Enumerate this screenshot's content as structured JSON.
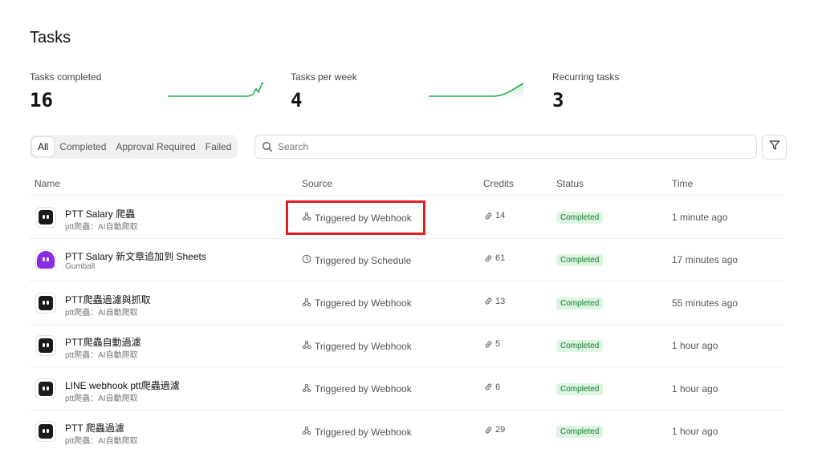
{
  "page": {
    "title": "Tasks"
  },
  "stats": [
    {
      "label": "Tasks completed",
      "value": "16"
    },
    {
      "label": "Tasks per week",
      "value": "4"
    },
    {
      "label": "Recurring tasks",
      "value": "3"
    }
  ],
  "tabs": [
    {
      "label": "All",
      "active": true
    },
    {
      "label": "Completed",
      "active": false
    },
    {
      "label": "Approval Required",
      "active": false
    },
    {
      "label": "Failed",
      "active": false
    }
  ],
  "search": {
    "placeholder": "Search",
    "value": ""
  },
  "table": {
    "columns": [
      "Name",
      "Source",
      "Credits",
      "Status",
      "Time"
    ],
    "rows": [
      {
        "name": "PTT Salary 爬蟲",
        "sub": "ptt爬蟲：AI自動爬取",
        "avatar": "robot-icon",
        "source": "Triggered by Webhook",
        "source_icon": "webhook-icon",
        "credits": "14",
        "status": "Completed",
        "time": "1 minute ago"
      },
      {
        "name": "PTT Salary 新文章追加到 Sheets",
        "sub": "Gumball",
        "avatar": "ghost-icon",
        "source": "Triggered by Schedule",
        "source_icon": "clock-icon",
        "credits": "61",
        "status": "Completed",
        "time": "17 minutes ago"
      },
      {
        "name": "PTT爬蟲過濾與抓取",
        "sub": "ptt爬蟲：AI自動爬取",
        "avatar": "robot-icon",
        "source": "Triggered by Webhook",
        "source_icon": "webhook-icon",
        "credits": "13",
        "status": "Completed",
        "time": "55 minutes ago"
      },
      {
        "name": "PTT爬蟲自動過濾",
        "sub": "ptt爬蟲：AI自動爬取",
        "avatar": "robot-icon",
        "source": "Triggered by Webhook",
        "source_icon": "webhook-icon",
        "credits": "5",
        "status": "Completed",
        "time": "1 hour ago"
      },
      {
        "name": "LINE webhook ptt爬蟲過濾",
        "sub": "ptt爬蟲：AI自動爬取",
        "avatar": "robot-icon",
        "source": "Triggered by Webhook",
        "source_icon": "webhook-icon",
        "credits": "6",
        "status": "Completed",
        "time": "1 hour ago"
      },
      {
        "name": "PTT 爬蟲過濾",
        "sub": "ptt爬蟲：AI自動爬取",
        "avatar": "robot-icon",
        "source": "Triggered by Webhook",
        "source_icon": "webhook-icon",
        "credits": "29",
        "status": "Completed",
        "time": "1 hour ago"
      }
    ]
  },
  "colors": {
    "spark": "#22b04b",
    "badge_bg": "#dcf5e1",
    "badge_text": "#167a2c",
    "highlight": "#e02020",
    "ghost": "#8a2be2"
  }
}
